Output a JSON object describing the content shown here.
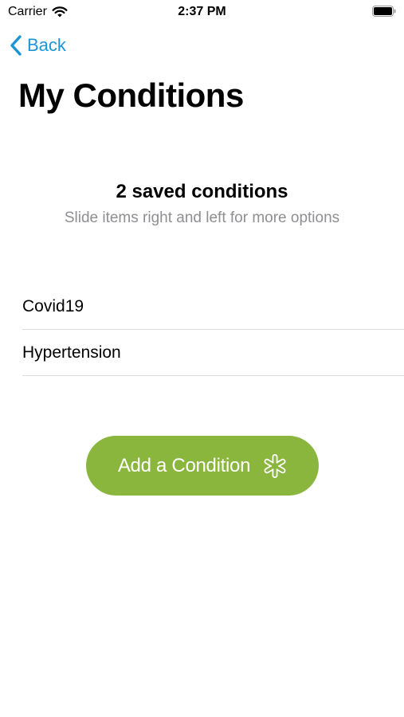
{
  "status_bar": {
    "carrier": "Carrier",
    "time": "2:37 PM",
    "wifi_icon": "wifi-icon",
    "battery_icon": "battery-icon"
  },
  "nav": {
    "back_label": "Back",
    "back_icon": "chevron-left-icon",
    "accent_color": "#1a95d6"
  },
  "page": {
    "title": "My Conditions"
  },
  "summary": {
    "title": "2 saved conditions",
    "subtitle": "Slide items right and left for more options"
  },
  "conditions": [
    {
      "label": "Covid19"
    },
    {
      "label": "Hypertension"
    }
  ],
  "add_button": {
    "label": "Add a Condition",
    "icon": "asterisk-flower-icon",
    "color": "#8ab63e"
  }
}
